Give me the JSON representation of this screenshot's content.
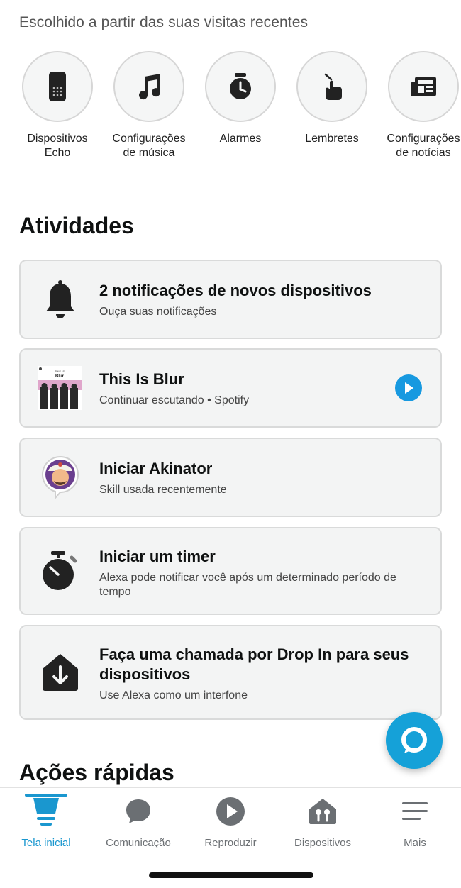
{
  "recent": {
    "heading": "Escolhido a partir das suas visitas recentes",
    "items": [
      {
        "label": "Dispositivos\nEcho",
        "icon": "echo-device-icon"
      },
      {
        "label": "Configurações\nde música",
        "icon": "music-note-icon"
      },
      {
        "label": "Alarmes",
        "icon": "alarm-clock-icon"
      },
      {
        "label": "Lembretes",
        "icon": "reminder-hand-icon"
      },
      {
        "label": "Configurações\nde notícias",
        "icon": "news-icon"
      }
    ]
  },
  "activities": {
    "title": "Atividades",
    "cards": [
      {
        "title": "2 notificações de novos dispositivos",
        "subtitle": "Ouça suas notificações",
        "icon": "bell-icon"
      },
      {
        "title": "This Is Blur",
        "subtitle": "Continuar escutando • Spotify",
        "icon": "album-cover",
        "cover_top": "THIS IS",
        "cover_name": "Blur"
      },
      {
        "title": "Iniciar Akinator",
        "subtitle": "Skill usada recentemente",
        "icon": "akinator-avatar-icon"
      },
      {
        "title": "Iniciar um timer",
        "subtitle": "Alexa pode notificar você após um determinado período de tempo",
        "icon": "stopwatch-icon"
      },
      {
        "title": "Faça uma chamada por Drop In para seus dispositivos",
        "subtitle": "Use Alexa como um interfone",
        "icon": "drop-in-icon"
      }
    ]
  },
  "quick_actions": {
    "title": "Ações rápidas"
  },
  "nav": {
    "items": [
      {
        "label": "Tela inicial",
        "icon": "home-icon",
        "active": true
      },
      {
        "label": "Comunicação",
        "icon": "chat-bubble-icon"
      },
      {
        "label": "Reproduzir",
        "icon": "play-icon"
      },
      {
        "label": "Dispositivos",
        "icon": "smart-home-icon"
      },
      {
        "label": "Mais",
        "icon": "menu-icon"
      }
    ]
  },
  "colors": {
    "accent": "#1a97cf",
    "alexa": "#15a1d8",
    "play": "#1799e0"
  }
}
